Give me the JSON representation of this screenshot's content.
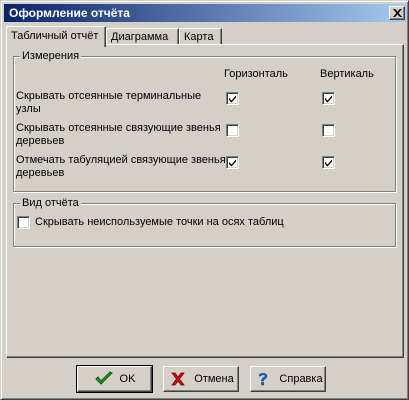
{
  "window": {
    "title": "Оформление отчёта"
  },
  "tabs": [
    {
      "label": "Табличный отчёт",
      "active": true
    },
    {
      "label": "Диаграмма",
      "active": false
    },
    {
      "label": "Карта",
      "active": false
    }
  ],
  "dimensions": {
    "legend": "Измерения",
    "col_horizontal": "Горизонталь",
    "col_vertical": "Вертикаль",
    "rows": [
      {
        "label": "Скрывать отсеянные терминальные узлы",
        "horizontal": true,
        "vertical": true
      },
      {
        "label": "Скрывать отсеянные связующие звенья деревьев",
        "horizontal": false,
        "vertical": false
      },
      {
        "label": "Отмечать табуляцией связующие звенья деревьев",
        "horizontal": true,
        "vertical": true
      }
    ]
  },
  "report_view": {
    "legend": "Вид отчёта",
    "hide_unused_points_label": "Скрывать неиспользуемые точки на осях таблиц",
    "hide_unused_points_checked": false
  },
  "buttons": {
    "ok": {
      "label": "OK",
      "icon": "check-icon"
    },
    "cancel": {
      "label": "Отмена",
      "icon": "cross-icon"
    },
    "help": {
      "label": "Справка",
      "icon": "question-icon"
    }
  },
  "colors": {
    "titlebar_start": "#0a246a",
    "titlebar_end": "#a6caf0",
    "face": "#d4d0c8",
    "ok_icon": "#1fa01f",
    "cancel_icon": "#d01010",
    "help_icon": "#1f6fd8"
  }
}
